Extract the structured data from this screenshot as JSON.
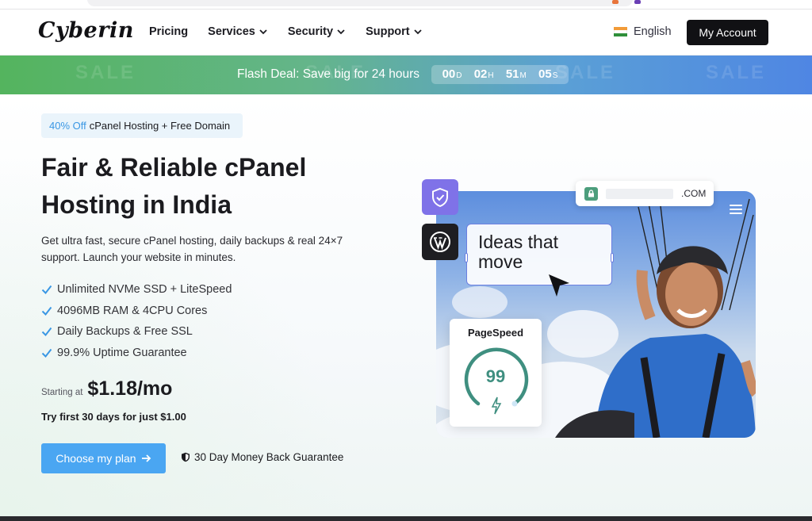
{
  "header": {
    "logo": "Cyberin",
    "nav": [
      {
        "label": "Pricing",
        "has_dropdown": false
      },
      {
        "label": "Services",
        "has_dropdown": true
      },
      {
        "label": "Security",
        "has_dropdown": true
      },
      {
        "label": "Support",
        "has_dropdown": true
      }
    ],
    "language": "English",
    "account_button": "My Account"
  },
  "banner": {
    "text": "Flash Deal: Save big for 24 hours",
    "countdown": {
      "days": "00",
      "days_label": "D",
      "hours": "02",
      "hours_label": "H",
      "minutes": "51",
      "minutes_label": "M",
      "seconds": "05",
      "seconds_label": "S"
    },
    "background_text": "SALE"
  },
  "hero": {
    "offer_highlight": "40% Off",
    "offer_text": "cPanel Hosting + Free Domain",
    "title": "Fair & Reliable cPanel Hosting in India",
    "subtitle": "Get ultra fast, secure cPanel hosting, daily backups & real 24×7 support. Launch your website in minutes.",
    "features": [
      "Unlimited NVMe SSD + LiteSpeed",
      "4096MB RAM & 4CPU Cores",
      "Daily Backups & Free SSL",
      "99.9% Uptime Guarantee"
    ],
    "price_label": "Starting at",
    "price": "$1.18/mo",
    "trial": "Try first 30 days for just $1.00",
    "cta": "Choose my plan",
    "guarantee": "30 Day Money Back Guarantee"
  },
  "illustration": {
    "domain_tld": ".COM",
    "ideas_text": "Ideas that move",
    "pagespeed_title": "PageSpeed",
    "pagespeed_score": "99",
    "pagespeed_value": 99
  },
  "colors": {
    "accent": "#4aa6f2",
    "offer_highlight": "#3a97e4",
    "banner_green": "#54b45e",
    "banner_blue": "#4f86e3",
    "gauge": "#3f8f80",
    "shield_tile": "#7f72e8"
  },
  "icons": [
    "chevron-down-icon",
    "india-flag-icon",
    "check-icon",
    "arrow-right-icon",
    "shield-icon",
    "lock-icon",
    "wordpress-icon",
    "menu-icon",
    "cursor-icon",
    "bolt-icon"
  ]
}
